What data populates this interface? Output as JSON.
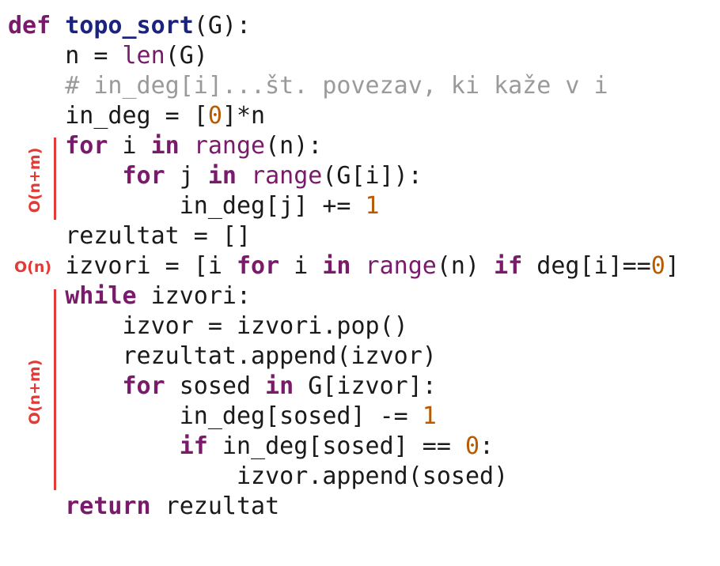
{
  "code_lines": [
    [
      {
        "t": "def",
        "c": "kw"
      },
      {
        "t": " ",
        "c": "plain"
      },
      {
        "t": "topo_sort",
        "c": "fn"
      },
      {
        "t": "(G):",
        "c": "plain"
      }
    ],
    [
      {
        "t": "    n = ",
        "c": "plain"
      },
      {
        "t": "len",
        "c": "bi"
      },
      {
        "t": "(G)",
        "c": "plain"
      }
    ],
    [
      {
        "t": "    # in_deg[i]...št. povezav, ki kaže v i",
        "c": "cm"
      }
    ],
    [
      {
        "t": "    in_deg = [",
        "c": "plain"
      },
      {
        "t": "0",
        "c": "num"
      },
      {
        "t": "]*n",
        "c": "plain"
      }
    ],
    [
      {
        "t": "    ",
        "c": "plain"
      },
      {
        "t": "for",
        "c": "kw"
      },
      {
        "t": " i ",
        "c": "plain"
      },
      {
        "t": "in",
        "c": "kw"
      },
      {
        "t": " ",
        "c": "plain"
      },
      {
        "t": "range",
        "c": "bi"
      },
      {
        "t": "(n):",
        "c": "plain"
      }
    ],
    [
      {
        "t": "        ",
        "c": "plain"
      },
      {
        "t": "for",
        "c": "kw"
      },
      {
        "t": " j ",
        "c": "plain"
      },
      {
        "t": "in",
        "c": "kw"
      },
      {
        "t": " ",
        "c": "plain"
      },
      {
        "t": "range",
        "c": "bi"
      },
      {
        "t": "(G[i]):",
        "c": "plain"
      }
    ],
    [
      {
        "t": "            in_deg[j] += ",
        "c": "plain"
      },
      {
        "t": "1",
        "c": "num"
      }
    ],
    [
      {
        "t": "    rezultat = []",
        "c": "plain"
      }
    ],
    [
      {
        "t": "    izvori = [i ",
        "c": "plain"
      },
      {
        "t": "for",
        "c": "kw"
      },
      {
        "t": " i ",
        "c": "plain"
      },
      {
        "t": "in",
        "c": "kw"
      },
      {
        "t": " ",
        "c": "plain"
      },
      {
        "t": "range",
        "c": "bi"
      },
      {
        "t": "(n) ",
        "c": "plain"
      },
      {
        "t": "if",
        "c": "kw"
      },
      {
        "t": " deg[i]==",
        "c": "plain"
      },
      {
        "t": "0",
        "c": "num"
      },
      {
        "t": "]",
        "c": "plain"
      }
    ],
    [
      {
        "t": "    ",
        "c": "plain"
      },
      {
        "t": "while",
        "c": "kw"
      },
      {
        "t": " izvori:",
        "c": "plain"
      }
    ],
    [
      {
        "t": "        izvor = izvori.pop()",
        "c": "plain"
      }
    ],
    [
      {
        "t": "        rezultat.append(izvor)",
        "c": "plain"
      }
    ],
    [
      {
        "t": "        ",
        "c": "plain"
      },
      {
        "t": "for",
        "c": "kw"
      },
      {
        "t": " sosed ",
        "c": "plain"
      },
      {
        "t": "in",
        "c": "kw"
      },
      {
        "t": " G[izvor]:",
        "c": "plain"
      }
    ],
    [
      {
        "t": "            in_deg[sosed] -= ",
        "c": "plain"
      },
      {
        "t": "1",
        "c": "num"
      }
    ],
    [
      {
        "t": "            ",
        "c": "plain"
      },
      {
        "t": "if",
        "c": "kw"
      },
      {
        "t": " in_deg[sosed] == ",
        "c": "plain"
      },
      {
        "t": "0",
        "c": "num"
      },
      {
        "t": ":",
        "c": "plain"
      }
    ],
    [
      {
        "t": "                izvor.append(sosed)",
        "c": "plain"
      }
    ],
    [
      {
        "t": "    ",
        "c": "plain"
      },
      {
        "t": "return",
        "c": "kw"
      },
      {
        "t": " rezultat",
        "c": "plain"
      }
    ]
  ],
  "annotations": {
    "for_loops": "O(n+m)",
    "izvori_line": "O(n)",
    "while_loop": "O(n+m)"
  },
  "colors": {
    "keyword": "#7a1a6a",
    "function_name": "#1a237e",
    "number": "#b85a00",
    "comment": "#9a9a9a",
    "annotation": "#e53935"
  }
}
